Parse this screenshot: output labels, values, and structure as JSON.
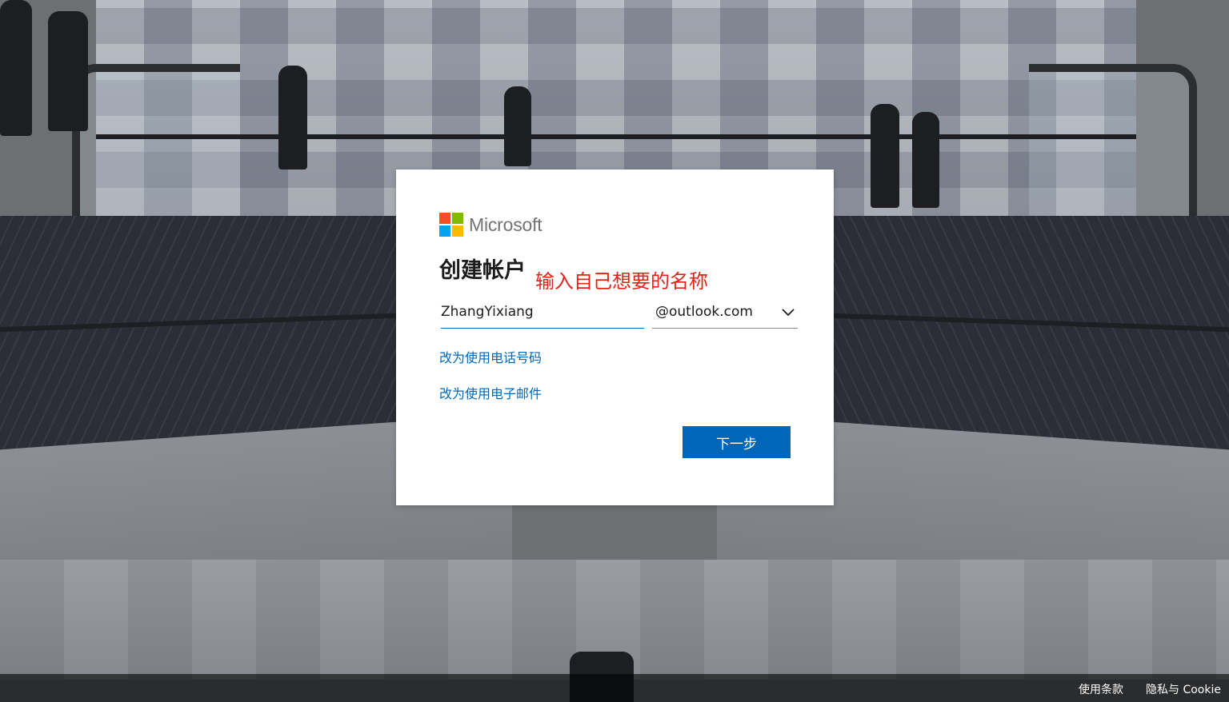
{
  "brand": {
    "name": "Microsoft",
    "logo_colors": [
      "#f25022",
      "#7fba00",
      "#00a4ef",
      "#ffb900"
    ]
  },
  "form": {
    "title": "创建帐户",
    "annotation": "输入自己想要的名称",
    "username_value": "ZhangYixiang",
    "domain_selected": "@outlook.com",
    "link_phone": "改为使用电话号码",
    "link_email": "改为使用电子邮件",
    "next_label": "下一步"
  },
  "footer": {
    "terms": "使用条款",
    "privacy": "隐私与 Cookie"
  },
  "colors": {
    "accent": "#0067b8",
    "annotation": "#e2231a"
  }
}
